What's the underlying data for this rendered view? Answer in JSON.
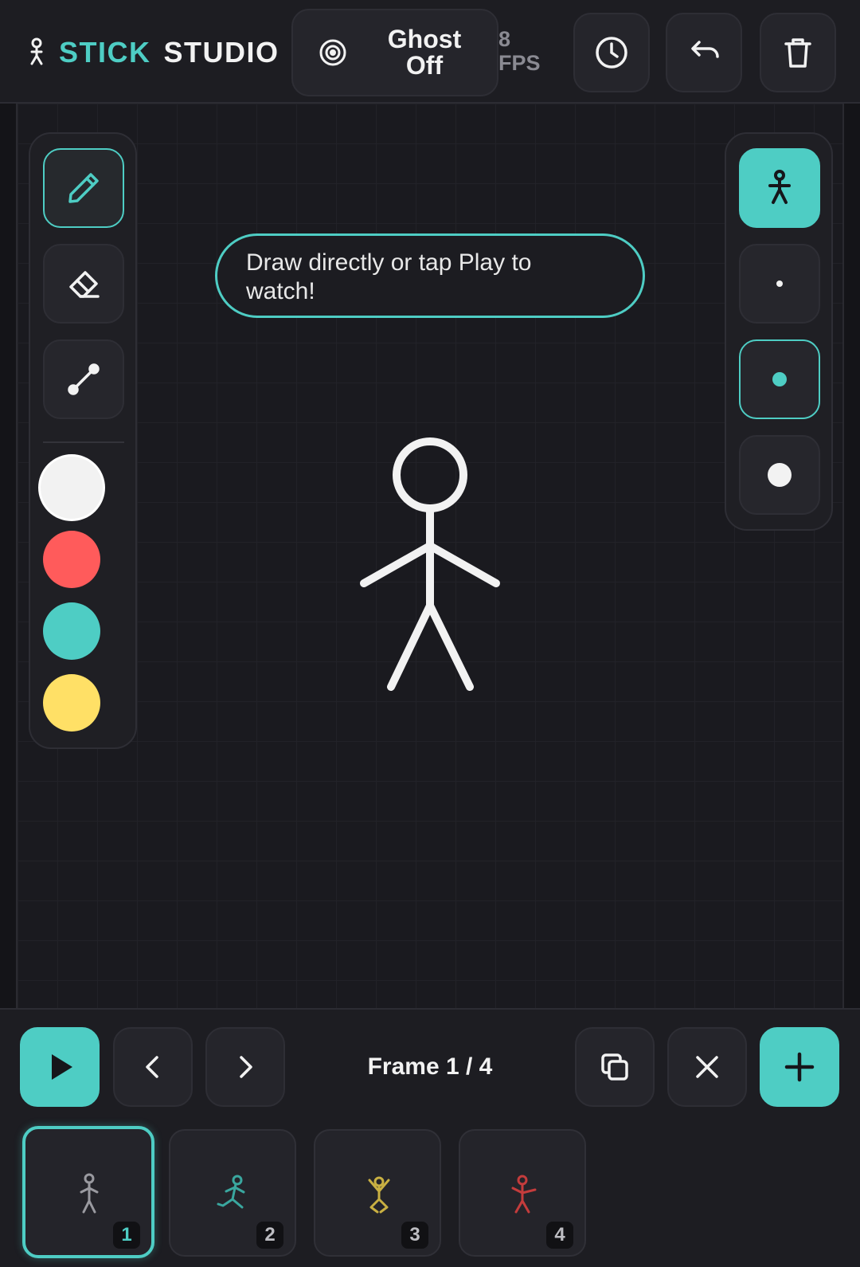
{
  "app": {
    "brand_word1": "STICK",
    "brand_word2": "STUDIO",
    "brand_icon": "stick-figure-icon"
  },
  "header": {
    "ghost": {
      "line1": "Ghost",
      "line2": "Off",
      "icon": "target-icon"
    },
    "fps": {
      "value": "8",
      "unit": "FPS"
    },
    "buttons": [
      {
        "icon": "clock-icon"
      },
      {
        "icon": "undo-icon"
      },
      {
        "icon": "trash-icon"
      }
    ]
  },
  "tools": {
    "items": [
      {
        "icon": "pencil-icon",
        "active": true
      },
      {
        "icon": "eraser-icon",
        "active": false
      },
      {
        "icon": "line-tool-icon",
        "active": false
      }
    ],
    "colors": [
      "#f2f2f2",
      "#ff5b5b",
      "#4ecdc4",
      "#ffe066"
    ],
    "selected_color": "#f2f2f2"
  },
  "hint": {
    "line1": "Draw directly or tap Play to",
    "line2": "watch!"
  },
  "brush": {
    "mode_icon": "stick-figure-icon",
    "sizes": [
      "small",
      "medium",
      "large"
    ],
    "selected_size": "medium"
  },
  "timeline": {
    "frame_label": "Frame 1 / 4",
    "current_frame": 1,
    "total_frames": 4,
    "buttons": [
      {
        "icon": "play-icon"
      },
      {
        "icon": "chevron-left-icon"
      },
      {
        "icon": "chevron-right-icon"
      },
      {
        "icon": "duplicate-icon"
      },
      {
        "icon": "close-icon"
      },
      {
        "icon": "plus-icon"
      }
    ],
    "thumbnails": [
      {
        "number": "1",
        "color": "#9a9aa0"
      },
      {
        "number": "2",
        "color": "#3aa79f"
      },
      {
        "number": "3",
        "color": "#c9b042"
      },
      {
        "number": "4",
        "color": "#c43c3c"
      }
    ]
  },
  "colors": {
    "accent": "#4ecdc4",
    "background": "#141418",
    "panel": "#1f1f24"
  }
}
